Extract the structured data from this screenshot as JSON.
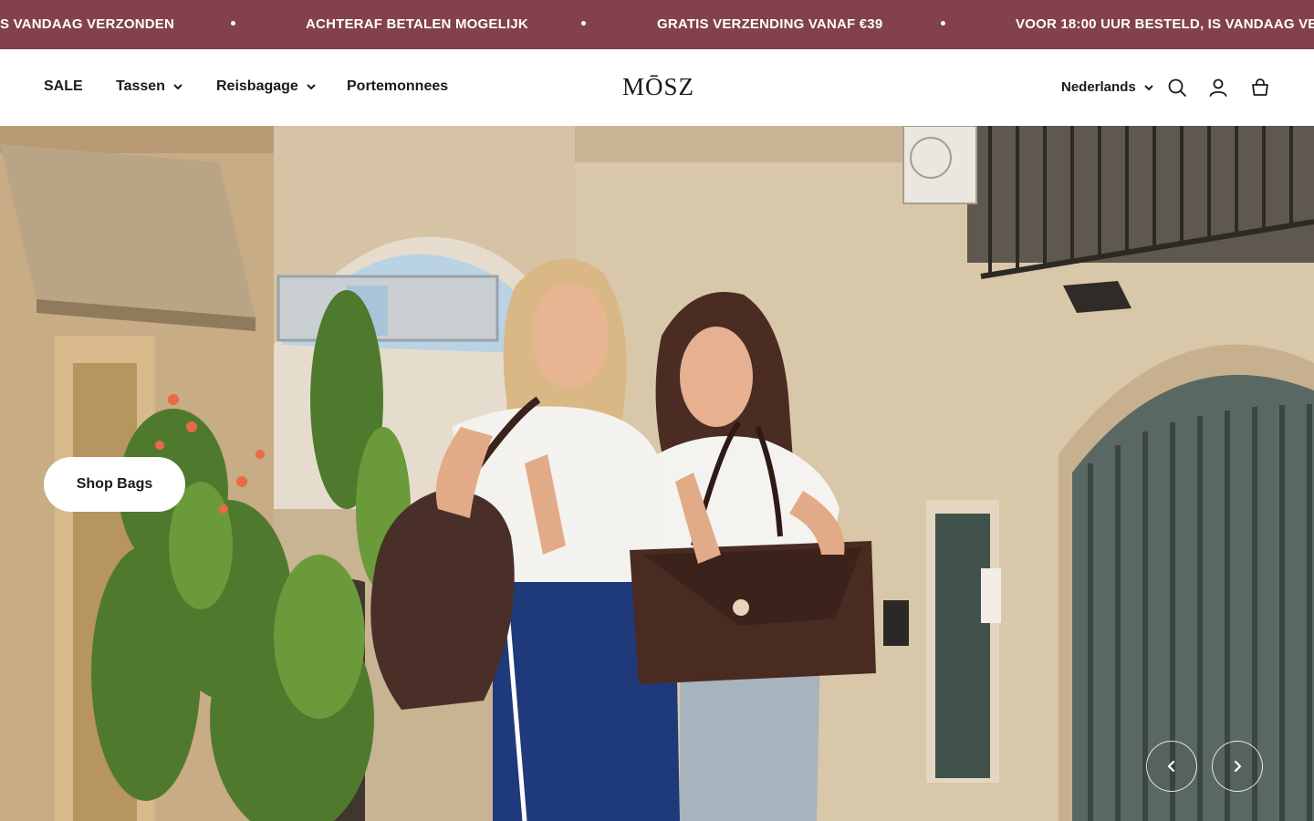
{
  "announcement": {
    "messages": [
      "S VANDAAG VERZONDEN",
      "ACHTERAF BETALEN MOGELIJK",
      "GRATIS VERZENDING VANAF €39",
      "VOOR 18:00 UUR BESTELD, IS VANDAAG VERZO"
    ],
    "background": "#82414b"
  },
  "header": {
    "nav": [
      {
        "label": "SALE",
        "has_dropdown": false
      },
      {
        "label": "Tassen",
        "has_dropdown": true
      },
      {
        "label": "Reisbagage",
        "has_dropdown": true
      },
      {
        "label": "Portemonnees",
        "has_dropdown": false
      }
    ],
    "logo": "MŌSZ",
    "language": "Nederlands",
    "icons": [
      "search-icon",
      "account-icon",
      "cart-icon"
    ]
  },
  "hero": {
    "cta_label": "Shop Bags",
    "controls": [
      "chevron-left-icon",
      "chevron-right-icon"
    ]
  }
}
